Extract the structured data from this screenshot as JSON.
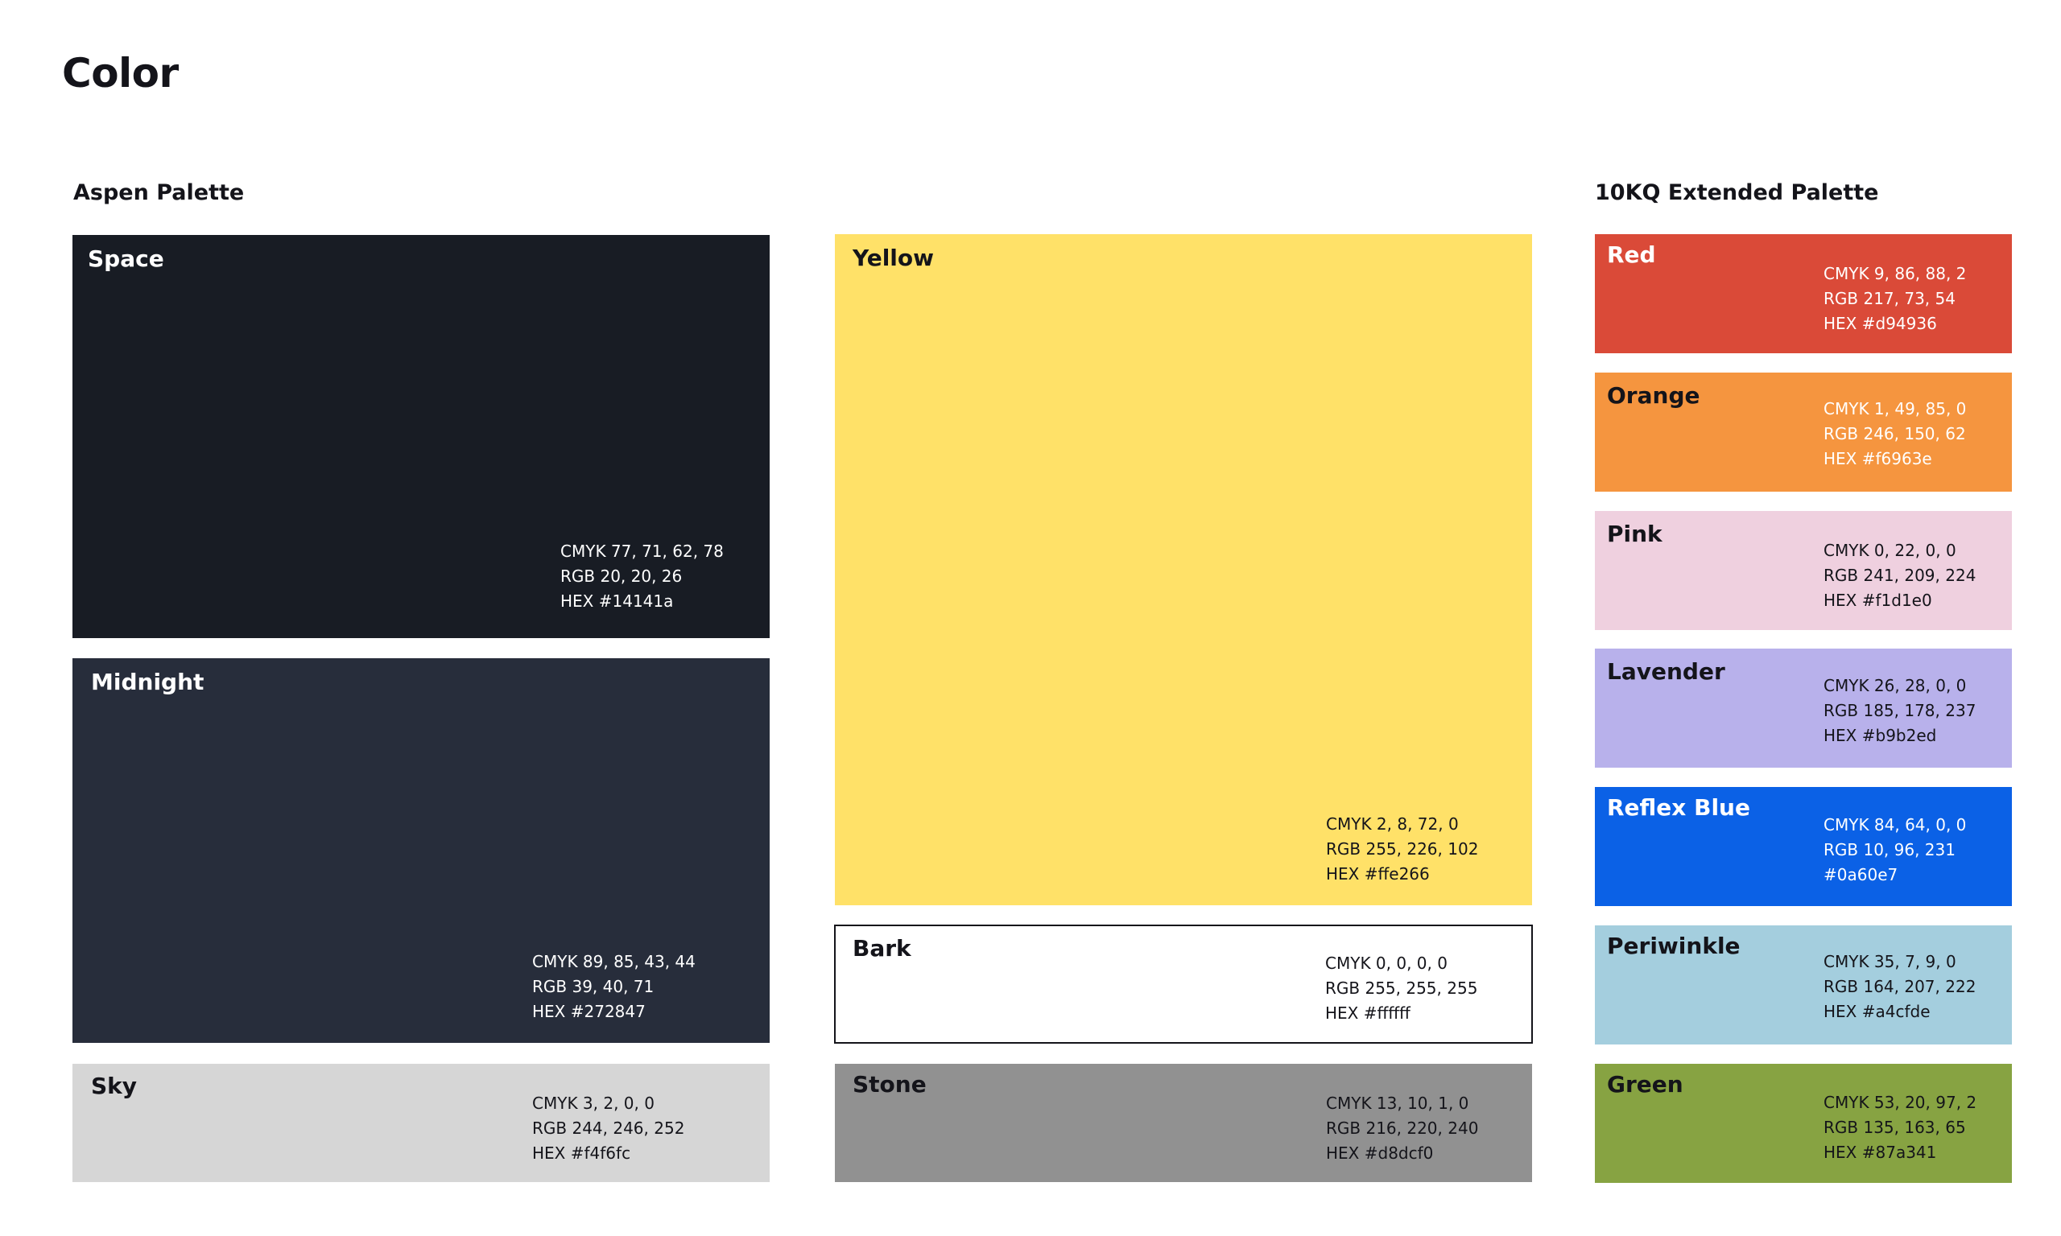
{
  "page": {
    "title": "Color"
  },
  "aspen": {
    "title": "Aspen Palette",
    "swatches": [
      {
        "name": "Space",
        "cmyk": "CMYK 77, 71, 62, 78",
        "rgb": "RGB 20, 20, 26",
        "hex": "HEX #14141a",
        "color": "#181c24"
      },
      {
        "name": "Midnight",
        "cmyk": "CMYK 89, 85, 43, 44",
        "rgb": "RGB 39, 40, 71",
        "hex": "HEX #272847",
        "color": "#272d3b"
      },
      {
        "name": "Sky",
        "cmyk": "CMYK 3, 2, 0, 0",
        "rgb": "RGB 244, 246, 252",
        "hex": "HEX #f4f6fc",
        "color": "#d6d6d6"
      },
      {
        "name": "Yellow",
        "cmyk": "CMYK 2, 8, 72, 0",
        "rgb": "RGB 255, 226, 102",
        "hex": "HEX #ffe266",
        "color": "#ffe168"
      },
      {
        "name": "Bark",
        "cmyk": "CMYK 0, 0, 0, 0",
        "rgb": "RGB 255, 255, 255",
        "hex": "HEX #ffffff",
        "color": "#ffffff"
      },
      {
        "name": "Stone",
        "cmyk": "CMYK 13, 10, 1, 0",
        "rgb": "RGB 216, 220, 240",
        "hex": "HEX #d8dcf0",
        "color": "#919191"
      }
    ]
  },
  "extended": {
    "title": "10KQ Extended Palette",
    "swatches": [
      {
        "name": "Red",
        "cmyk": "CMYK 9, 86, 88, 2",
        "rgb": "RGB 217, 73, 54",
        "hex": "HEX #d94936",
        "color": "#da4a38"
      },
      {
        "name": "Orange",
        "cmyk": "CMYK 1, 49, 85, 0",
        "rgb": "RGB 246, 150, 62",
        "hex": "HEX #f6963e",
        "color": "#f5953f"
      },
      {
        "name": "Pink",
        "cmyk": "CMYK 0, 22, 0, 0",
        "rgb": "RGB 241, 209, 224",
        "hex": "HEX #f1d1e0",
        "color": "#efd0df"
      },
      {
        "name": "Lavender",
        "cmyk": "CMYK 26, 28, 0, 0",
        "rgb": "RGB 185, 178, 237",
        "hex": "HEX #b9b2ed",
        "color": "#b8b1eb"
      },
      {
        "name": "Reflex Blue",
        "cmyk": "CMYK 84, 64, 0, 0",
        "rgb": "RGB 10, 96, 231",
        "hex": "#0a60e7",
        "color": "#0b61e6"
      },
      {
        "name": "Periwinkle",
        "cmyk": "CMYK 35, 7, 9, 0",
        "rgb": "RGB 164, 207, 222",
        "hex": "HEX #a4cfde",
        "color": "#a4cede"
      },
      {
        "name": "Green",
        "cmyk": "CMYK 53, 20, 97, 2",
        "rgb": "RGB 135, 163, 65",
        "hex": "HEX #87a341",
        "color": "#87a342"
      }
    ]
  }
}
